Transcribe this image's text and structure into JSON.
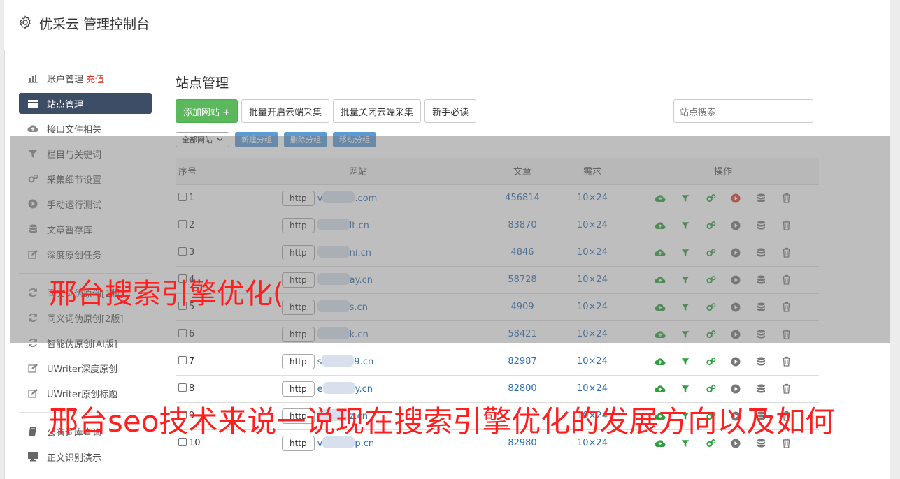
{
  "app": {
    "title": "优采云 管理控制台"
  },
  "sidebar": {
    "items": [
      {
        "label": "账户管理",
        "accent": "充值",
        "icon": "bar-chart-icon"
      },
      {
        "label": "站点管理",
        "icon": "server-icon",
        "active": true
      },
      {
        "label": "接口文件相关",
        "icon": "cloud-upload-icon"
      },
      {
        "label": "栏目与关键词",
        "icon": "filter-icon"
      },
      {
        "label": "采集细节设置",
        "icon": "gears-icon"
      },
      {
        "label": "手动运行测试",
        "icon": "play-circle-icon"
      },
      {
        "label": "文章暂存库",
        "icon": "database-icon"
      },
      {
        "label": "深度原创任务",
        "icon": "edit-icon"
      }
    ],
    "items2": [
      {
        "label": "同义词伪原创[1版]",
        "icon": "refresh-icon"
      },
      {
        "label": "同义词伪原创[2版]",
        "icon": "refresh-icon"
      },
      {
        "label": "智能伪原创[AI版]",
        "icon": "refresh-icon"
      },
      {
        "label": "UWriter深度原创",
        "icon": "edit-icon"
      },
      {
        "label": "UWriter原创标题",
        "icon": "edit-icon"
      }
    ],
    "items3": [
      {
        "label": "公有词库查询",
        "icon": "book-icon"
      },
      {
        "label": "正文识别演示",
        "icon": "monitor-icon"
      }
    ]
  },
  "main": {
    "title": "站点管理",
    "buttons": {
      "add": "添加网站 +",
      "batch_on": "批量开启云端采集",
      "batch_off": "批量关闭云端采集",
      "guide": "新手必读"
    },
    "search_placeholder": "站点搜索",
    "group_select": "全部网站",
    "group_buttons": {
      "new": "新建分组",
      "delete": "删除分组",
      "move": "移动分组"
    },
    "table": {
      "headers": {
        "num": "序号",
        "site": "网站",
        "articles": "文章",
        "demand": "需求",
        "ops": "操作"
      },
      "http_label": "http",
      "rows": [
        {
          "num": "1",
          "site": "v",
          "site_suffix": ".com",
          "articles": "456814",
          "demand": "10×24",
          "running": true
        },
        {
          "num": "2",
          "site": "",
          "site_suffix": "lt.cn",
          "articles": "83870",
          "demand": "10×24"
        },
        {
          "num": "3",
          "site": "",
          "site_suffix": "ni.cn",
          "articles": "4846",
          "demand": "10×24"
        },
        {
          "num": "4",
          "site": "",
          "site_suffix": "ay.cn",
          "articles": "58728",
          "demand": "10×24"
        },
        {
          "num": "5",
          "site": "",
          "site_suffix": "s.cn",
          "articles": "4909",
          "demand": "10×24"
        },
        {
          "num": "6",
          "site": "",
          "site_suffix": "k.cn",
          "articles": "58421",
          "demand": "10×24"
        },
        {
          "num": "7",
          "site": "s",
          "site_suffix": "9.cn",
          "articles": "82987",
          "demand": "10×24"
        },
        {
          "num": "8",
          "site": "e",
          "site_suffix": "y.cn",
          "articles": "82800",
          "demand": "10×24"
        },
        {
          "num": "9",
          "site": "",
          "site_suffix": "z.cn",
          "articles": "",
          "demand": "10×24"
        },
        {
          "num": "10",
          "site": "v",
          "site_suffix": "p.cn",
          "articles": "82980",
          "demand": "10×24"
        }
      ]
    }
  },
  "watermarks": {
    "line1": "邢台搜索引擎优化(",
    "line2": "邢台seo技术来说一说现在搜索引擎优化的发展方向以及如何"
  },
  "colors": {
    "active_nav": "#3e4d66",
    "green": "#5cb85c",
    "accent_red": "#e23c2c",
    "link": "#2f6db0",
    "op_green": "#2e9e3e",
    "watermark": "#ff1f1f"
  }
}
